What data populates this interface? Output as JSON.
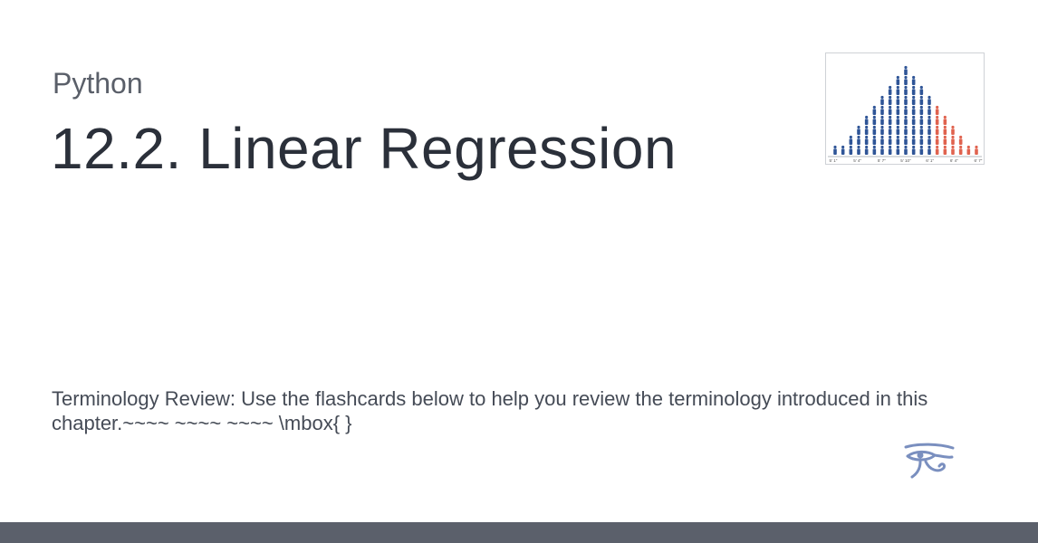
{
  "card": {
    "site_name": "Python",
    "title": "12.2. Linear Regression",
    "description": "Terminology Review: Use the flashcards below to help you review the terminology introduced in this chapter.~~~~ ~~~~ ~~~~ \\mbox{ }"
  },
  "thumbnail": {
    "tick_labels": [
      "5' 1\"",
      "5' 4\"",
      "5' 7\"",
      "5' 10\"",
      "6' 1\"",
      "6' 4\"",
      "6' 7\""
    ],
    "colors": {
      "blue": "#2f5597",
      "red": "#e0634f"
    }
  },
  "logo": {
    "icon": "eye-of-horus-icon",
    "color": "#7a8fbf"
  },
  "footer": {
    "color": "#5b606b"
  }
}
